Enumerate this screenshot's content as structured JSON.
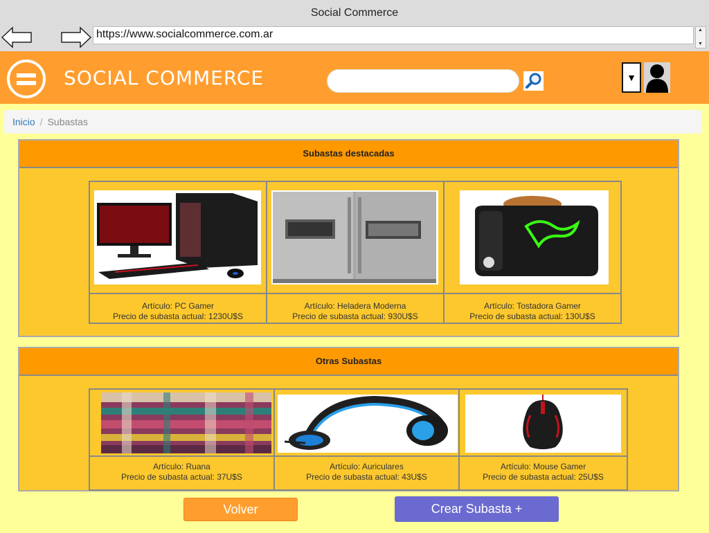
{
  "browser": {
    "window_title": "Social Commerce",
    "url": "https://www.socialcommerce.com.ar"
  },
  "header": {
    "brand": "SOCIAL COMMERCE",
    "search_placeholder": "",
    "dropdown_glyph": "▼",
    "accent_color": "#ff9e2e"
  },
  "breadcrumb": {
    "home": "Inicio",
    "separator": "/",
    "current": "Subastas"
  },
  "featured": {
    "title": "Subastas destacadas",
    "items": [
      {
        "article": "Artículo: PC Gamer",
        "price": "Precio de subasta actual: 1230U$S",
        "image": "pc-gamer-image"
      },
      {
        "article": "Artículo: Heladera Moderna",
        "price": "Precio de subasta actual: 930U$S",
        "image": "fridge-image"
      },
      {
        "article": "Artículo: Tostadora Gamer",
        "price": "Precio de subasta actual: 130U$S",
        "image": "toaster-image"
      }
    ]
  },
  "other": {
    "title": "Otras Subastas",
    "items": [
      {
        "article": "Artículo: Ruana",
        "price": "Precio de subasta actual: 37U$S",
        "image": "ruana-image"
      },
      {
        "article": "Artículo: Auriculares",
        "price": "Precio de subasta actual: 43U$S",
        "image": "headphones-image"
      },
      {
        "article": "Artículo: Mouse Gamer",
        "price": "Precio de subasta actual: 25U$S",
        "image": "mouse-image"
      }
    ]
  },
  "actions": {
    "back": "Volver",
    "create": "Crear Subasta  +",
    "create_color": "#6a6ad0"
  }
}
